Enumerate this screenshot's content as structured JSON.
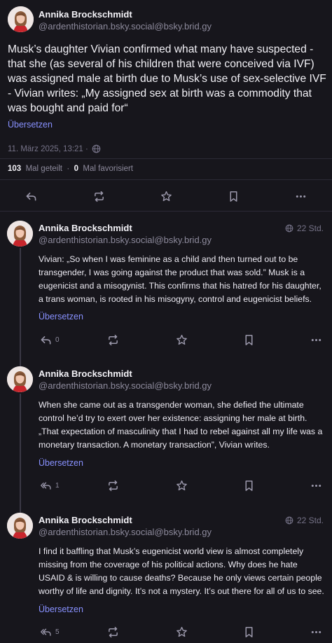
{
  "main_post": {
    "author_name": "Annika Brockschmidt",
    "author_handle": "@ardenthistorian.bsky.social@bsky.brid.gy",
    "text": "Musk’s daughter Vivian confirmed what many have suspected - that she (as several of his children that were conceived via IVF) was assigned male at birth due to Musk’s use of sex-selective IVF - Vivian writes: „My assigned sex at birth was a commodity that was bought and paid for“",
    "translate_label": "Übersetzen",
    "timestamp": "11. März 2025, 13:21 ·",
    "shares_count": "103",
    "shares_label": "Mal geteilt",
    "stats_separator": "·",
    "favorites_count": "0",
    "favorites_label": "Mal favorisiert"
  },
  "replies": [
    {
      "author_name": "Annika Brockschmidt",
      "author_handle": "@ardenthistorian.bsky.social@bsky.brid.gy",
      "time": "22 Std.",
      "text": "Vivian: „So when I was feminine as a child and then turned out to be transgender, I was going against the product that was sold.” Musk is a eugenicist and a misogynist. This confirms that his hatred for his daughter, a trans woman, is rooted in his misogyny, control and eugenicist beliefs.",
      "translate_label": "Übersetzen",
      "reply_count": "0"
    },
    {
      "author_name": "Annika Brockschmidt",
      "author_handle": "@ardenthistorian.bsky.social@bsky.brid.gy",
      "time": "",
      "text": "When she came out as a transgender woman, she defied the ultimate control he’d try to exert over her existence: assigning her male at birth. „That expectation of masculinity that I had to rebel against all my life was a monetary transaction. A monetary transaction”, Vivian writes.",
      "translate_label": "Übersetzen",
      "reply_count": "1"
    },
    {
      "author_name": "Annika Brockschmidt",
      "author_handle": "@ardenthistorian.bsky.social@bsky.brid.gy",
      "time": "22 Std.",
      "text": "I find it baffling that Musk’s eugenicist world view is almost completely missing from the coverage of his political actions. Why does he hate USAID & is willing to cause deaths? Because he only views certain people worthy of life and dignity. It’s not a mystery. It’s out there for all of us to see.",
      "translate_label": "Übersetzen",
      "reply_count": "5"
    }
  ],
  "colors": {
    "background": "#17161c",
    "link": "#8891ff",
    "muted": "#8d8a9c",
    "icon": "#9b98ab"
  },
  "icons": [
    "reply-icon",
    "boost-icon",
    "star-icon",
    "bookmark-icon",
    "more-icon",
    "globe-icon"
  ]
}
